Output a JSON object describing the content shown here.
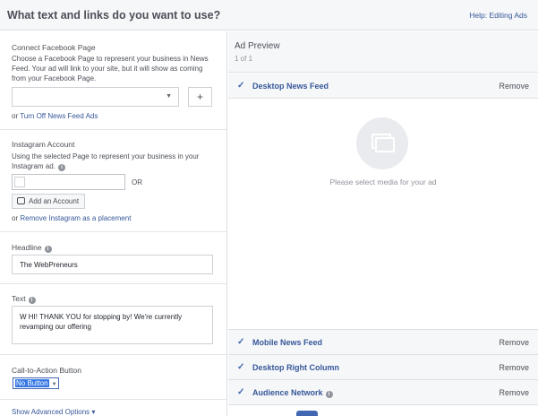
{
  "header": {
    "title": "What text and links do you want to use?",
    "help": "Help: Editing Ads"
  },
  "facebook_page": {
    "label": "Connect Facebook Page",
    "description": "Choose a Facebook Page to represent your business in News Feed. Your ad will link to your site, but it will show as coming from your Facebook Page.",
    "selected_value": "",
    "add_label": "+",
    "or_text": "or",
    "turn_off_link": "Turn Off News Feed Ads"
  },
  "instagram": {
    "label": "Instagram Account",
    "description": "Using the selected Page to represent your business in your Instagram ad.",
    "or_text": "OR",
    "add_account": "Add an Account",
    "or_text2": "or",
    "remove_link": "Remove Instagram as a placement"
  },
  "headline": {
    "label": "Headline",
    "value": "The WebPreneurs"
  },
  "text": {
    "label": "Text",
    "value": "W HI! THANK YOU for stopping by! We're currently revamping our offering"
  },
  "cta": {
    "label": "Call-to-Action Button",
    "value": "No Button"
  },
  "advanced": {
    "label": "Show Advanced Options"
  },
  "preview": {
    "title": "Ad Preview",
    "count": "1 of 1",
    "placeholder": "Please select media for your ad",
    "remove_label": "Remove",
    "placements": [
      {
        "label": "Desktop News Feed"
      },
      {
        "label": "Mobile News Feed"
      },
      {
        "label": "Desktop Right Column"
      },
      {
        "label": "Audience Network"
      }
    ]
  },
  "icons": {
    "check": "checkmark-icon",
    "info": "info-icon",
    "media": "media-placeholder-icon",
    "dropdown": "chevron-down-icon"
  }
}
